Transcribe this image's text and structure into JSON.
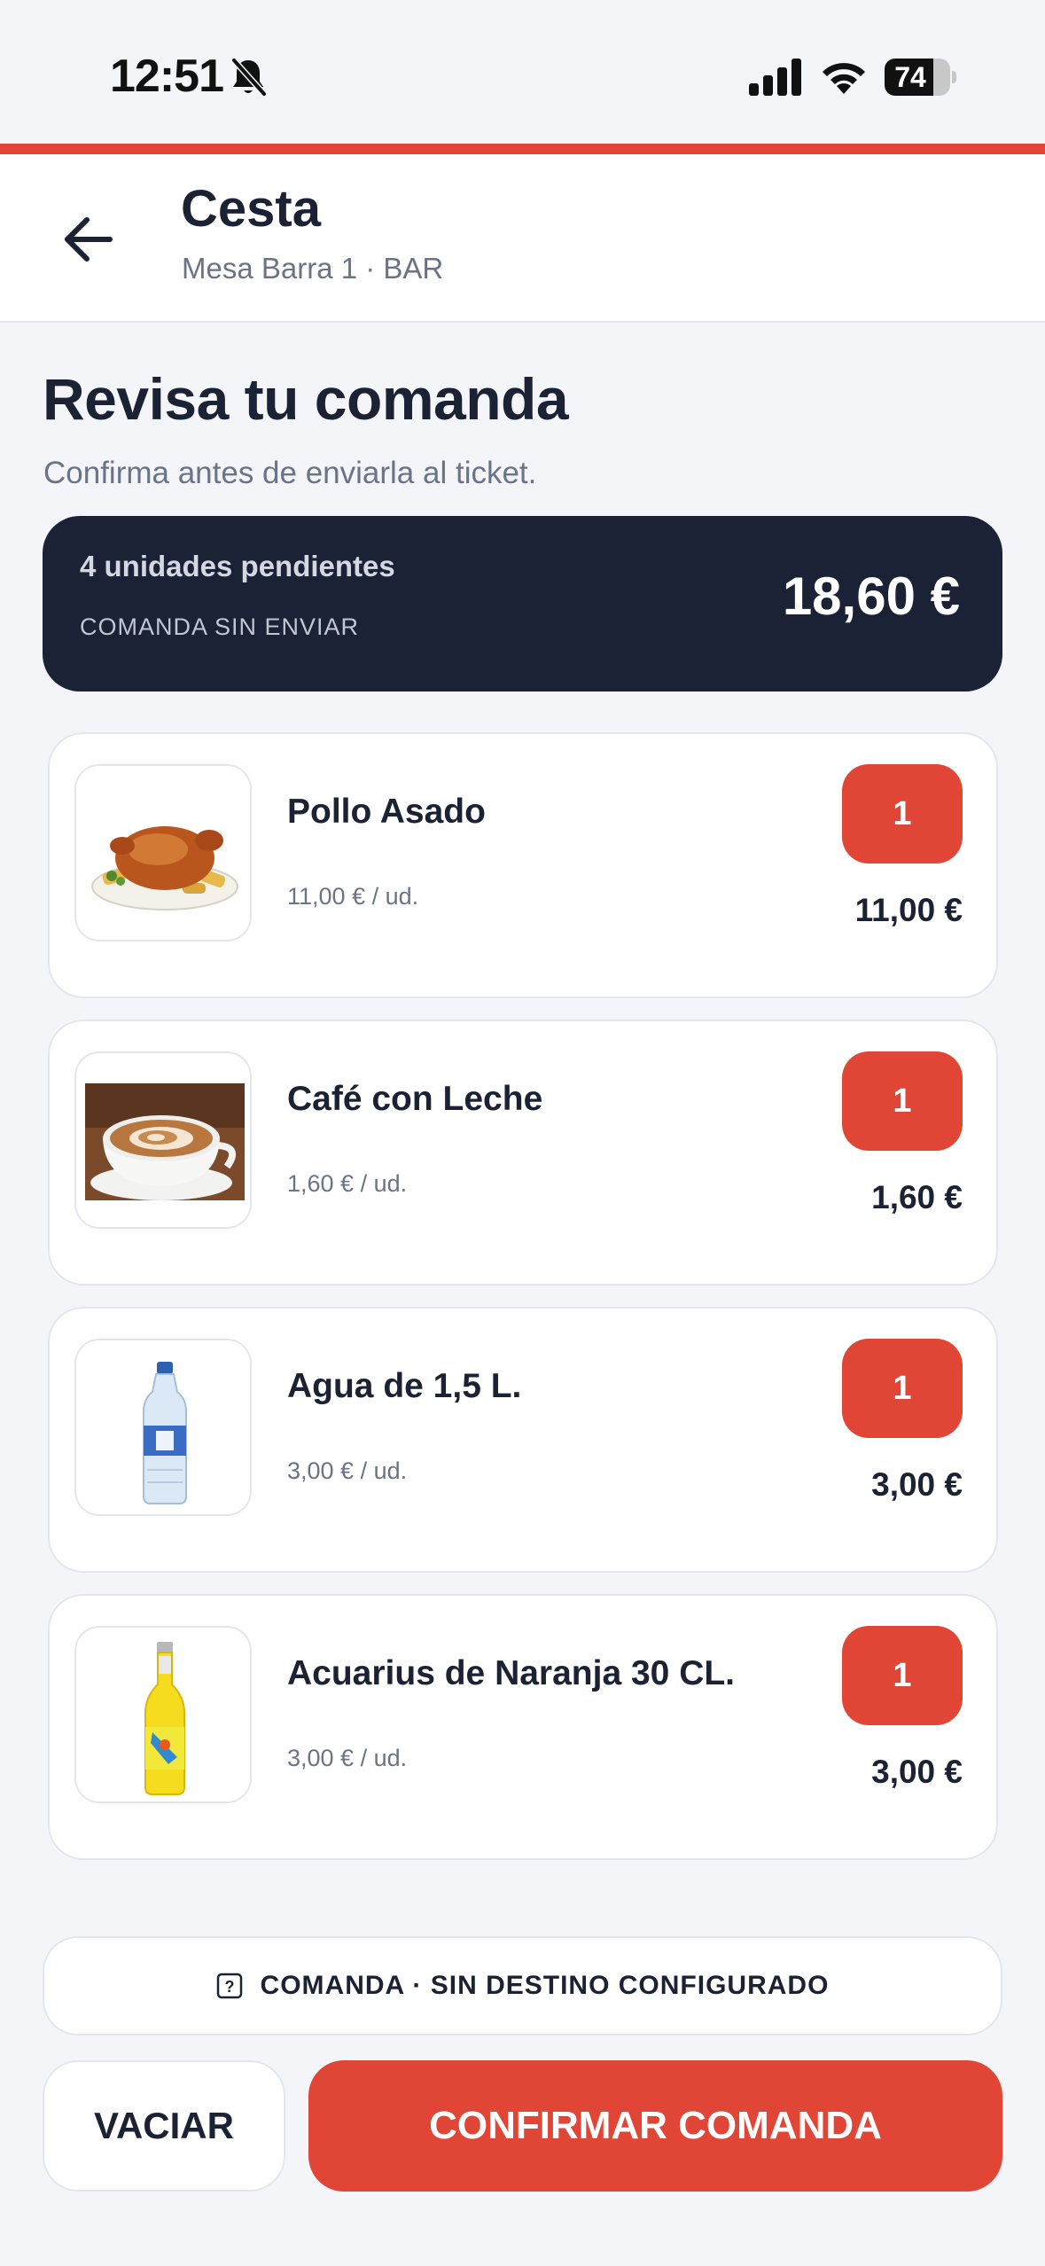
{
  "status_bar": {
    "time": "12:51",
    "battery": "74",
    "battery_level": 0.74,
    "icons": [
      "bell-muted-icon",
      "cellular-signal-icon",
      "wifi-icon",
      "battery-icon"
    ]
  },
  "header": {
    "title": "Cesta",
    "subtitle": "Mesa Barra 1 · BAR",
    "back_icon": "arrow-left-icon"
  },
  "main": {
    "title": "Revisa tu comanda",
    "subtitle": "Confirma antes de enviarla al ticket."
  },
  "summary": {
    "units": "4 unidades pendientes",
    "status": "COMANDA SIN ENVIAR",
    "total": "18,60 €"
  },
  "items": [
    {
      "name": "Pollo Asado",
      "unit_price": "11,00 € / ud.",
      "quantity": "1",
      "line_total": "11,00 €",
      "image": "roast-chicken-photo"
    },
    {
      "name": "Café con Leche",
      "unit_price": "1,60 € / ud.",
      "quantity": "1",
      "line_total": "1,60 €",
      "image": "latte-cup-photo"
    },
    {
      "name": "Agua de 1,5 L.",
      "unit_price": "3,00 € / ud.",
      "quantity": "1",
      "line_total": "3,00 €",
      "image": "water-bottle-photo"
    },
    {
      "name": "Acuarius de Naranja 30 CL.",
      "unit_price": "3,00 € / ud.",
      "quantity": "1",
      "line_total": "3,00 €",
      "image": "orange-drink-bottle-photo"
    }
  ],
  "destination": {
    "text": "COMANDA · SIN DESTINO CONFIGURADO",
    "icon": "question-square-icon"
  },
  "actions": {
    "clear_label": "VACIAR",
    "confirm_label": "CONFIRMAR COMANDA"
  },
  "colors": {
    "accent": "#e04535",
    "dark": "#1b2236",
    "background": "#f3f5f9",
    "text": "#1b2233",
    "muted": "#6b7486"
  }
}
